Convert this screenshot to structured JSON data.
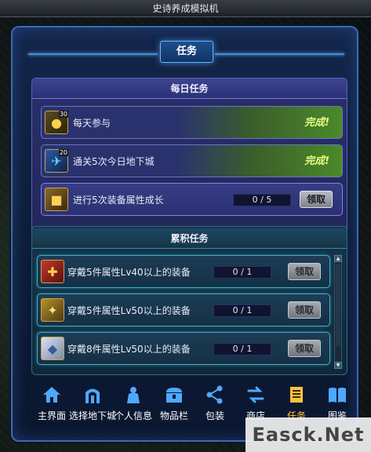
{
  "window": {
    "title": "史诗养成模拟机"
  },
  "dialog": {
    "title": "任务"
  },
  "daily": {
    "header": "每日任务",
    "tasks": [
      {
        "badge": "30",
        "label": "每天参与",
        "status": "完成!"
      },
      {
        "badge": "20",
        "label": "通关5次今日地下城",
        "status": "完成!"
      },
      {
        "label": "进行5次装备属性成长",
        "progress": "0 / 5",
        "button": "领取"
      }
    ]
  },
  "accumulated": {
    "header": "累积任务",
    "tasks": [
      {
        "label": "穿戴5件属性Lv40以上的装备",
        "progress": "0 / 1",
        "button": "领取"
      },
      {
        "label": "穿戴5件属性Lv50以上的装备",
        "progress": "0 / 1",
        "button": "领取"
      },
      {
        "label": "穿戴8件属性Lv50以上的装备",
        "progress": "0 / 1",
        "button": "领取"
      }
    ]
  },
  "nav": [
    {
      "label": "主界面",
      "icon": "home-icon"
    },
    {
      "label": "选择地下城",
      "icon": "gate-icon"
    },
    {
      "label": "个人信息",
      "icon": "character-icon"
    },
    {
      "label": "物品栏",
      "icon": "chest-icon"
    },
    {
      "label": "包装",
      "icon": "share-icon"
    },
    {
      "label": "商店",
      "icon": "exchange-icon"
    },
    {
      "label": "任务",
      "icon": "scroll-icon",
      "active": true
    },
    {
      "label": "图鉴",
      "icon": "book-icon"
    }
  ],
  "watermark": "Easck.Net",
  "colors": {
    "accent": "#3e8fd8",
    "done": "#e8ff80",
    "active_nav": "#ffc33a"
  }
}
